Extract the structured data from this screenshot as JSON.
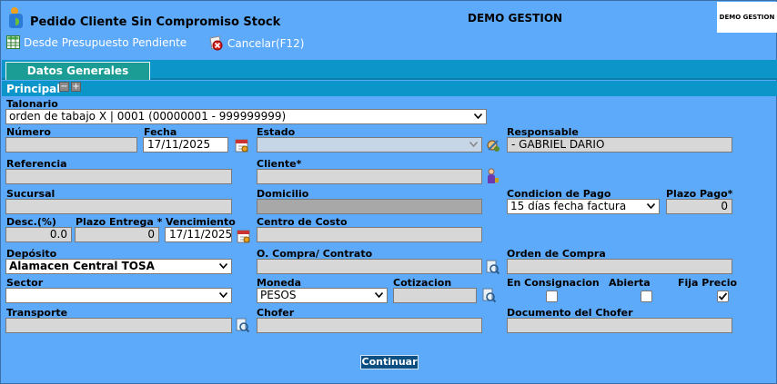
{
  "header": {
    "title": "Pedido Cliente Sin Compromiso Stock",
    "company": "DEMO GESTION",
    "company_logo_text": "DEMO GESTION"
  },
  "toolbar": {
    "from_quote_label": "Desde Presupuesto Pendiente",
    "cancel_label": "Cancelar(F12)"
  },
  "tabs": [
    {
      "label": "Datos Generales",
      "active": true
    }
  ],
  "section": {
    "title": "Principal"
  },
  "form": {
    "talonario": {
      "label": "Talonario",
      "value": "orden de tabajo X | 0001 (00000001 - 999999999)"
    },
    "numero": {
      "label": "Número",
      "value": ""
    },
    "fecha": {
      "label": "Fecha",
      "value": "17/11/2025"
    },
    "estado": {
      "label": "Estado",
      "value": ""
    },
    "responsable": {
      "label": "Responsable",
      "value": "- GABRIEL DARIO"
    },
    "referencia": {
      "label": "Referencia",
      "value": ""
    },
    "cliente": {
      "label": "Cliente*",
      "value": ""
    },
    "sucursal": {
      "label": "Sucursal",
      "value": ""
    },
    "domicilio": {
      "label": "Domicilio",
      "value": ""
    },
    "condicion_pago": {
      "label": "Condicion de Pago",
      "value": "15 días fecha factura"
    },
    "plazo_pago": {
      "label": "Plazo Pago*",
      "value": "0"
    },
    "descuento": {
      "label": "Desc.(%)",
      "value": "0.0"
    },
    "plazo_entrega": {
      "label": "Plazo Entrega *",
      "value": "0"
    },
    "vencimiento": {
      "label": "Vencimiento",
      "value": "17/11/2025"
    },
    "centro_costo": {
      "label": "Centro de Costo",
      "value": ""
    },
    "deposito": {
      "label": "Depósito",
      "value": "Alamacen Central TOSA"
    },
    "orden_compra_contrato": {
      "label": "O. Compra/ Contrato",
      "value": ""
    },
    "orden_compra": {
      "label": "Orden de Compra",
      "value": ""
    },
    "sector": {
      "label": "Sector",
      "value": ""
    },
    "moneda": {
      "label": "Moneda",
      "value": "PESOS"
    },
    "cotizacion": {
      "label": "Cotizacion",
      "value": ""
    },
    "en_consignacion": {
      "label": "En Consignacion",
      "checked": false
    },
    "abierta": {
      "label": "Abierta",
      "checked": false
    },
    "fija_precio": {
      "label": "Fija Precio",
      "checked": true
    },
    "transporte": {
      "label": "Transporte",
      "value": ""
    },
    "chofer": {
      "label": "Chofer",
      "value": ""
    },
    "documento_chofer": {
      "label": "Documento del Chofer",
      "value": ""
    }
  },
  "actions": {
    "continue_label": "Continuar"
  },
  "icons": {
    "app_logo": "app-logo-icon",
    "grid": "grid-icon",
    "cancel": "cancel-icon",
    "calendar": "calendar-icon",
    "lookup": "lookup-icon",
    "person": "person-icon"
  },
  "colors": {
    "background": "#5eaafa",
    "tabstrip": "#0b95c8",
    "tab_active": "#1b9d96",
    "input_disabled": "#d7d7d7",
    "button": "#0b4f82"
  }
}
